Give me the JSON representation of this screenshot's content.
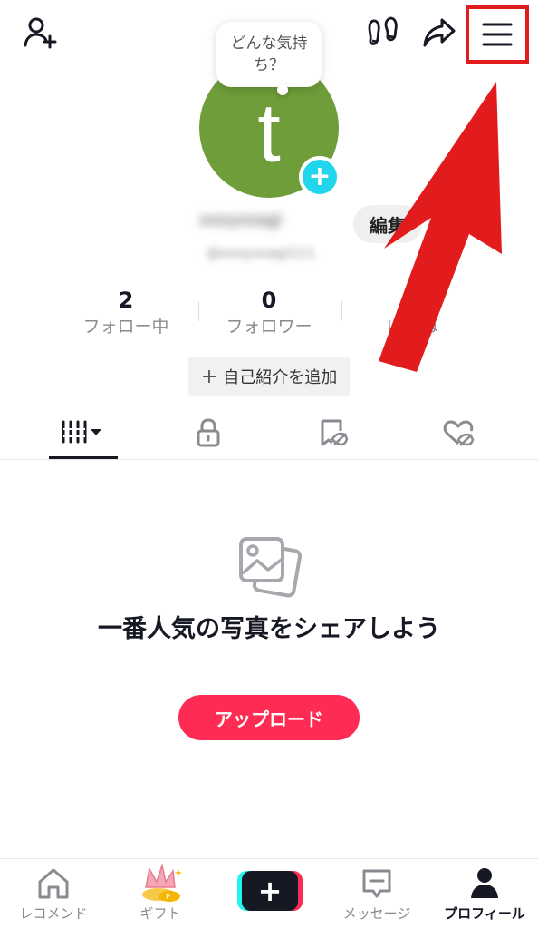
{
  "header": {
    "mood_prompt": "どんな気持ち？",
    "menu_highlight_color": "#e21c1c"
  },
  "profile": {
    "avatar_letter": "t",
    "avatar_color": "#6f9d39",
    "avatar_add": "+",
    "username": "xxxyxxagi",
    "handle": "@xxxyxxagi111",
    "edit_label": "編集",
    "bio_label": "自己紹介を追加",
    "bio_plus": "+"
  },
  "stats": {
    "following": {
      "count": "2",
      "label": "フォロー中"
    },
    "followers": {
      "count": "0",
      "label": "フォロワー"
    },
    "likes": {
      "count": "",
      "label": "いいね"
    }
  },
  "tabs": [
    "videos",
    "private",
    "reposts",
    "liked"
  ],
  "empty_state": {
    "title": "一番人気の写真をシェアしよう",
    "upload_label": "アップロード",
    "upload_color": "#fe2c55"
  },
  "bottom_nav": {
    "home": "レコメンド",
    "gift": "ギフト",
    "create": "+",
    "inbox": "メッセージ",
    "profile": "プロフィール"
  },
  "icons": [
    "add-friend-icon",
    "footprint-icon",
    "share-icon",
    "menu-icon",
    "grid-icon",
    "lock-icon",
    "repost-icon",
    "liked-icon",
    "photos-icon",
    "home-icon",
    "gift-icon",
    "inbox-icon",
    "profile-icon"
  ]
}
